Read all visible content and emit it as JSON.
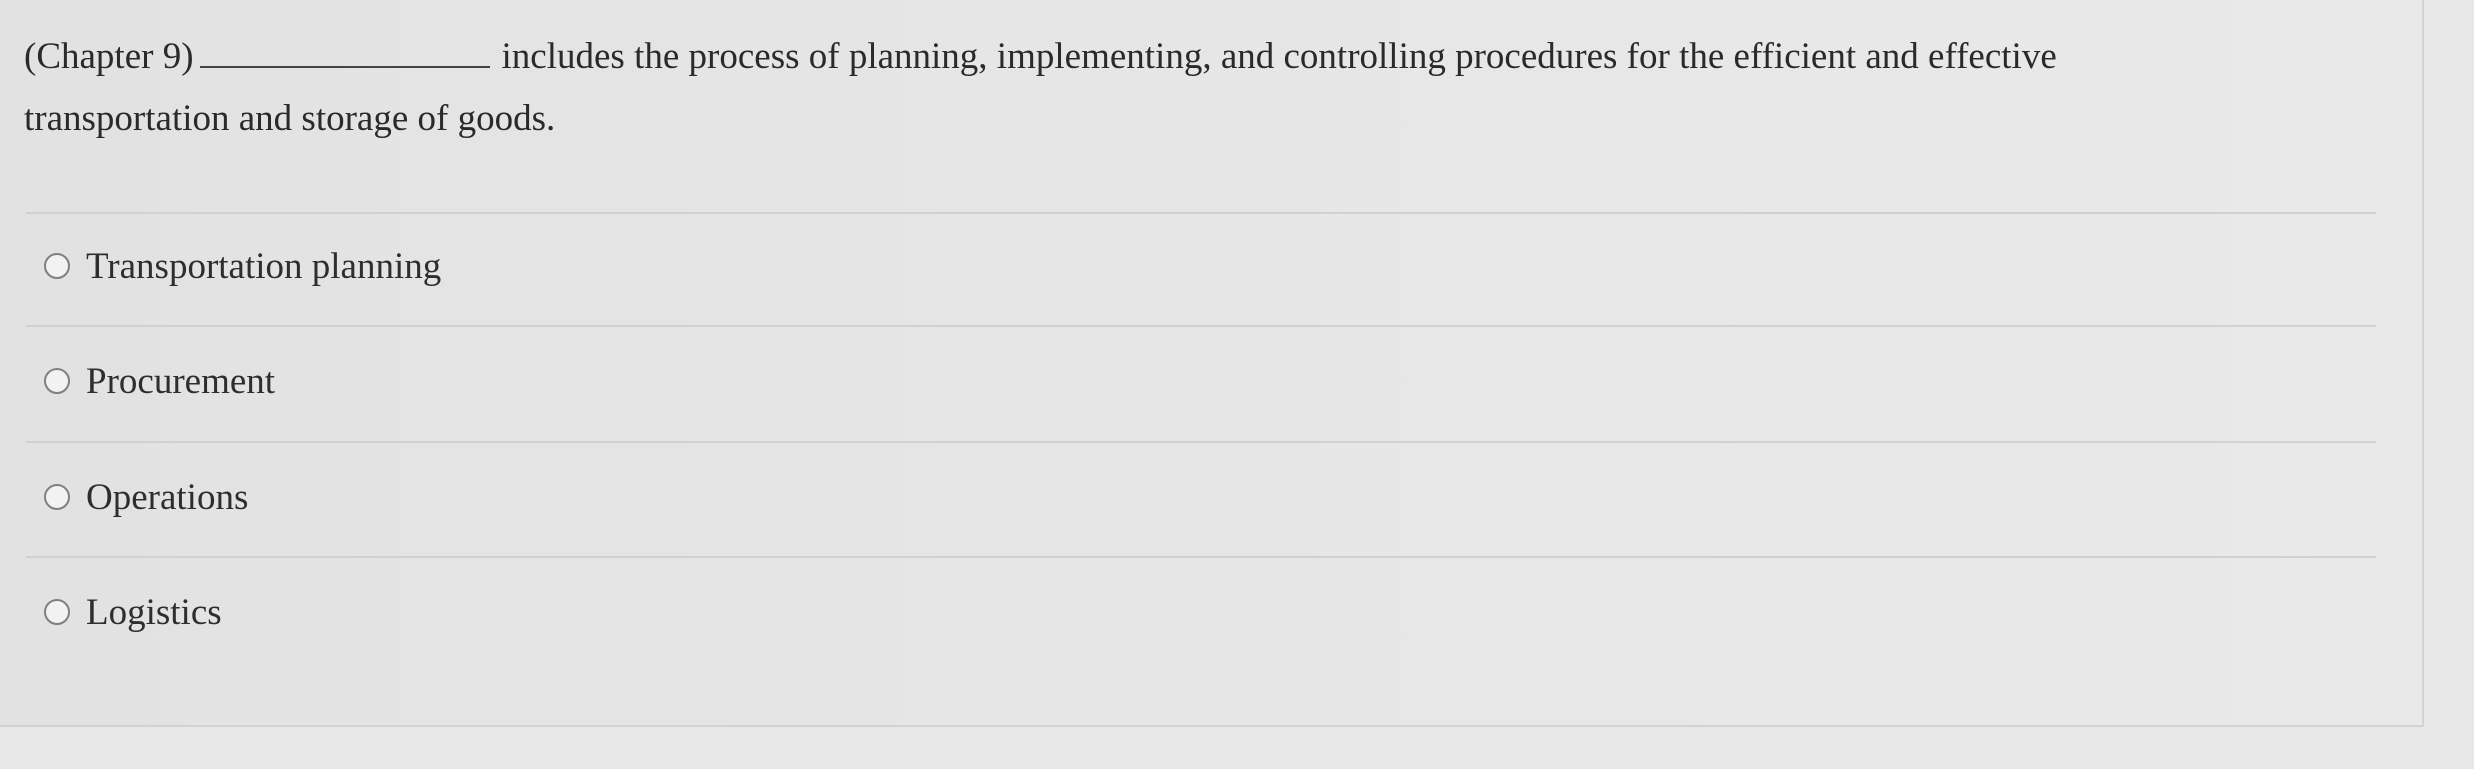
{
  "question": {
    "prefix": "(Chapter 9)",
    "line1_suffix": "includes the process of planning, implementing, and controlling procedures for the efficient and effective",
    "line2": "transportation and storage of goods."
  },
  "options": [
    {
      "label": "Transportation planning",
      "selected": false
    },
    {
      "label": "Procurement",
      "selected": false
    },
    {
      "label": "Operations",
      "selected": false
    },
    {
      "label": "Logistics",
      "selected": false
    }
  ]
}
